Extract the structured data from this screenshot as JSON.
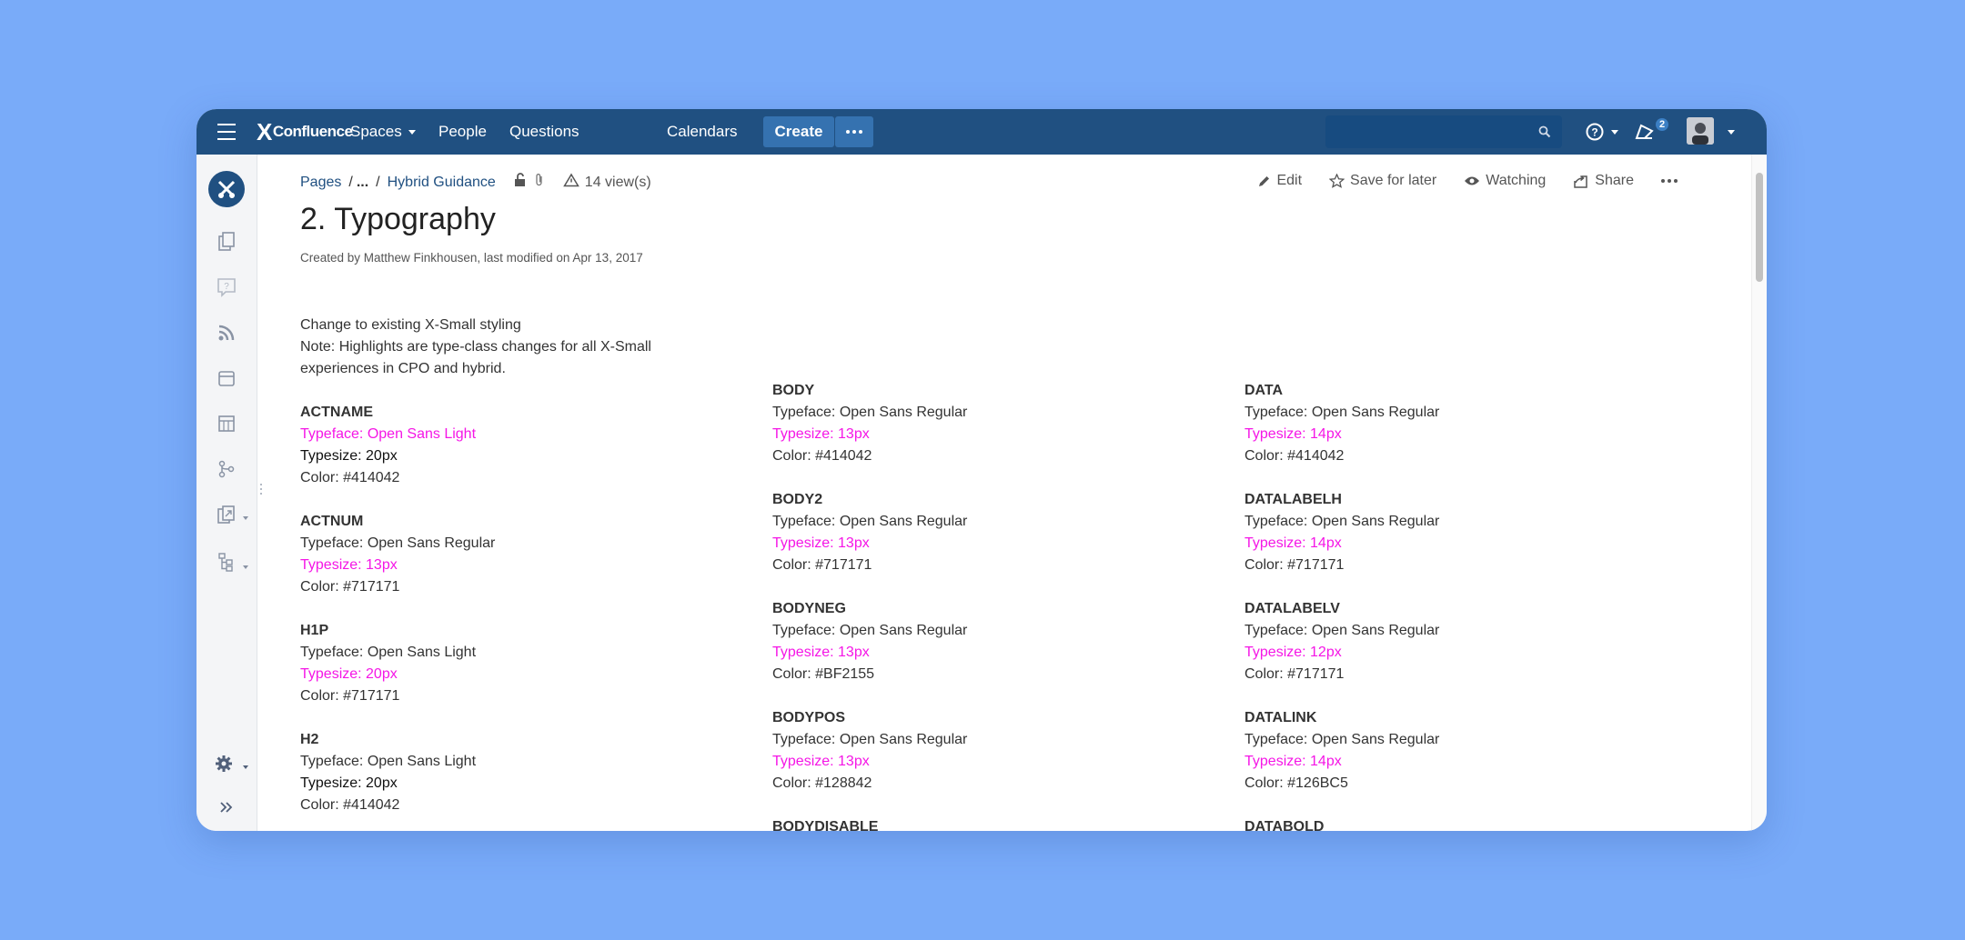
{
  "nav": {
    "brand": "Confluence",
    "brand_mark": "X",
    "spaces": "Spaces",
    "people": "People",
    "questions": "Questions",
    "calendars": "Calendars",
    "create": "Create",
    "search_placeholder": "",
    "notification_count": "2"
  },
  "sidebar": {
    "icons": [
      "pages-icon",
      "questions-icon",
      "blog-feed-icon",
      "calendar-icon",
      "spreadsheet-icon",
      "branch-icon",
      "export-icon",
      "tree-icon"
    ],
    "settings_icon": "gear-icon",
    "expand_icon": "double-chevron-right-icon"
  },
  "breadcrumb": {
    "pages": "Pages",
    "ellipsis": "...",
    "parent": "Hybrid Guidance",
    "views": "14 view(s)"
  },
  "actions": {
    "edit": "Edit",
    "save_for_later": "Save for later",
    "watching": "Watching",
    "share": "Share"
  },
  "page": {
    "title": "2. Typography",
    "byline": "Created by Matthew Finkhousen, last modified on Apr 13, 2017"
  },
  "intro": {
    "line1": "Change to existing X-Small styling",
    "line2": "Note: Highlights are type-class changes for all X-Small experiences in CPO and hybrid."
  },
  "columns": [
    [
      {
        "name": "ACTNAME",
        "typeface": "Typeface: Open Sans Light",
        "typesize": "Typesize: 20px",
        "color": "Color: #414042",
        "hl_face": true,
        "hl_size": false
      },
      {
        "name": "ACTNUM",
        "typeface": "Typeface: Open Sans Regular",
        "typesize": "Typesize: 13px",
        "color": "Color: #717171",
        "hl_face": false,
        "hl_size": true
      },
      {
        "name": "H1P",
        "typeface": "Typeface: Open Sans Light",
        "typesize": "Typesize: 20px",
        "color": "Color: #717171",
        "hl_face": false,
        "hl_size": true
      },
      {
        "name": "H2",
        "typeface": "Typeface: Open Sans Light",
        "typesize": "Typesize: 20px",
        "color": "Color: #414042",
        "hl_face": false,
        "hl_size": false
      }
    ],
    [
      {
        "name": "BODY",
        "typeface": "Typeface: Open Sans Regular",
        "typesize": "Typesize: 13px",
        "color": "Color: #414042",
        "hl_face": false,
        "hl_size": true
      },
      {
        "name": "BODY2",
        "typeface": "Typeface: Open Sans Regular",
        "typesize": "Typesize: 13px",
        "color": "Color: #717171",
        "hl_face": false,
        "hl_size": true
      },
      {
        "name": "BODYNEG",
        "typeface": "Typeface: Open Sans Regular",
        "typesize": "Typesize: 13px",
        "color": "Color: #BF2155",
        "hl_face": false,
        "hl_size": true
      },
      {
        "name": "BODYPOS",
        "typeface": "Typeface: Open Sans Regular",
        "typesize": "Typesize: 13px",
        "color": "Color: #128842",
        "hl_face": false,
        "hl_size": true
      },
      {
        "name": "BODYDISABLE"
      }
    ],
    [
      {
        "name": "DATA",
        "typeface": "Typeface: Open Sans Regular",
        "typesize": "Typesize: 14px",
        "color": "Color: #414042",
        "hl_face": false,
        "hl_size": true
      },
      {
        "name": "DATALABELH",
        "typeface": "Typeface: Open Sans Regular",
        "typesize": "Typesize: 14px",
        "color": "Color: #717171",
        "hl_face": false,
        "hl_size": true
      },
      {
        "name": "DATALABELV",
        "typeface": "Typeface: Open Sans Regular",
        "typesize": "Typesize: 12px",
        "color": "Color: #717171",
        "hl_face": false,
        "hl_size": true
      },
      {
        "name": "DATALINK",
        "typeface": "Typeface: Open Sans Regular",
        "typesize": "Typesize: 14px",
        "color": "Color: #126BC5",
        "hl_face": false,
        "hl_size": true
      },
      {
        "name": "DATABOLD"
      }
    ]
  ],
  "colors": {
    "nav_bg": "#205081",
    "highlight": "#f516e6",
    "link": "#205081",
    "backdrop": "#79abf9"
  }
}
